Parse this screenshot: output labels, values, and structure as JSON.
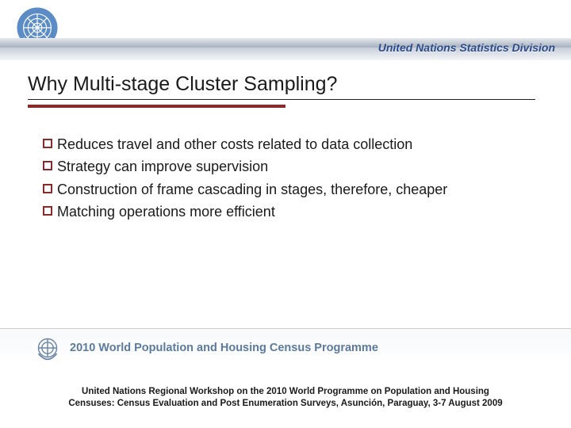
{
  "header": {
    "org_text": "United Nations Statistics Division"
  },
  "slide": {
    "title": "Why Multi-stage Cluster Sampling?",
    "bullets": [
      "Reduces travel and other costs related to data collection",
      "Strategy can improve supervision",
      "Construction of frame cascading in stages, therefore, cheaper",
      "Matching operations more efficient"
    ]
  },
  "footer": {
    "programme_text": "2010 World Population and Housing Census Programme",
    "caption_line1": "United Nations Regional Workshop on the 2010 World Programme on Population and Housing",
    "caption_line2": "Censuses: Census Evaluation and Post Enumeration Surveys, Asunción, Paraguay, 3-7 August 2009"
  }
}
